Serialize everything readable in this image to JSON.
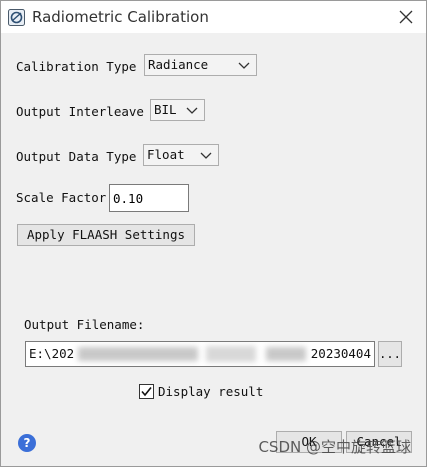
{
  "window": {
    "title": "Radiometric Calibration",
    "icon": "app-icon",
    "close_icon": "close-icon"
  },
  "form": {
    "calibration_type_label": "Calibration Type",
    "calibration_type_value": "Radiance",
    "output_interleave_label": "Output Interleave",
    "output_interleave_value": "BIL",
    "output_data_type_label": "Output Data Type",
    "output_data_type_value": "Float",
    "scale_factor_label": "Scale Factor",
    "scale_factor_value": "0.10",
    "apply_flaash_label": "Apply FLAASH Settings",
    "output_filename_label": "Output Filename:",
    "output_filename_start": "E:\\202",
    "output_filename_end": "20230404",
    "browse_label": "...",
    "display_result_label": "Display result",
    "display_result_checked": true
  },
  "footer": {
    "help_icon": "help-icon",
    "help_glyph": "?",
    "ok_label": "OK",
    "cancel_label": "Cancel",
    "watermark": "CSDN @空中旋转篮球"
  }
}
